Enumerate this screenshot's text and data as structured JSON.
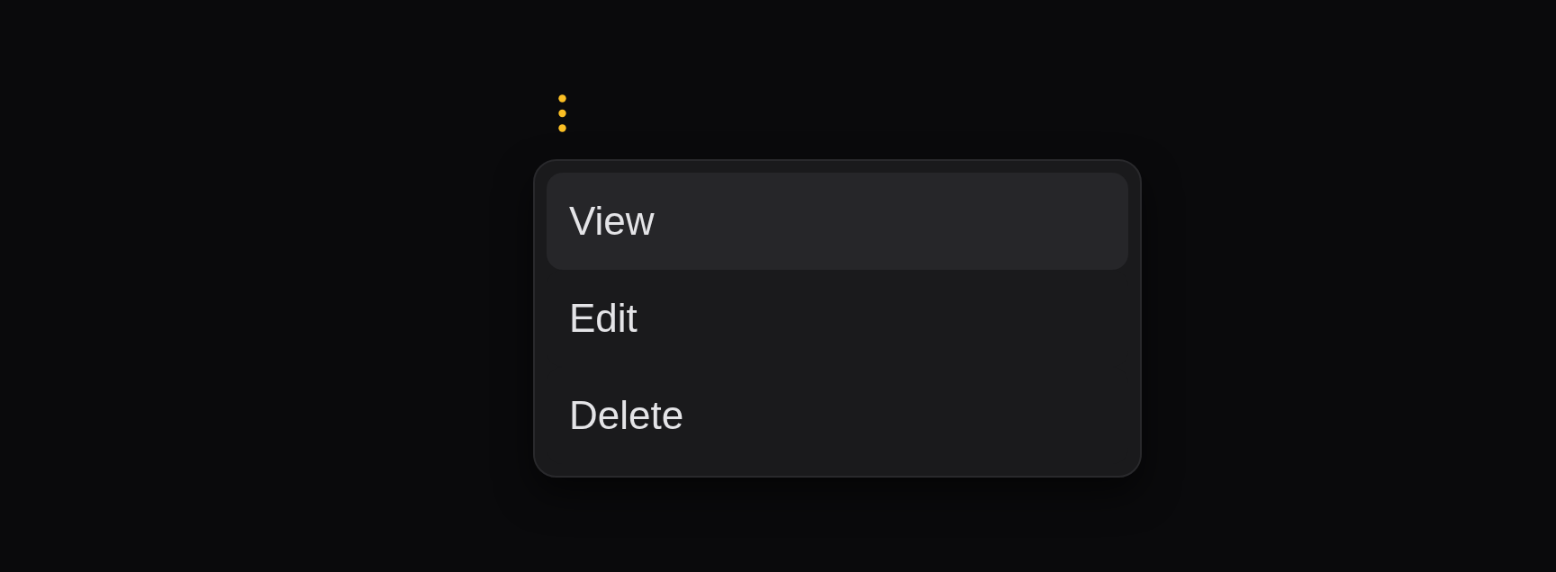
{
  "menu": {
    "items": [
      {
        "label": "View",
        "highlighted": true
      },
      {
        "label": "Edit",
        "highlighted": false
      },
      {
        "label": "Delete",
        "highlighted": false
      }
    ]
  }
}
